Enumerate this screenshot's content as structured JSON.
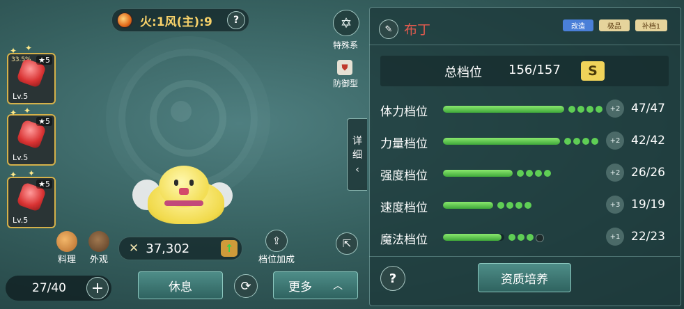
{
  "top": {
    "element_text": "火:1风(主):9",
    "help_label": "?",
    "type_label": "特殊系",
    "defense_label": "防御型",
    "type_icon": "star-of-david-icon"
  },
  "runes": [
    {
      "level": "Lv.5",
      "stars": "5",
      "pct": "33.5%"
    },
    {
      "level": "Lv.5",
      "stars": "5",
      "pct": ""
    },
    {
      "level": "Lv.5",
      "stars": "5",
      "pct": ""
    }
  ],
  "actions": {
    "cooking_label": "料理",
    "appearance_label": "外观",
    "power_value": "37,302",
    "rank_bonus_label": "档位加成",
    "count": "27/40",
    "rest_label": "休息",
    "more_label": "更多",
    "detail_label_1": "详",
    "detail_label_2": "细"
  },
  "panel": {
    "pet_name": "布丁",
    "badges": [
      "改造",
      "极品",
      "补档1"
    ],
    "total_label": "总档位",
    "total_value": "156/157",
    "grade": "S",
    "stats": [
      {
        "label": "体力档位",
        "fill": 1.0,
        "dots_filled": 4,
        "dots_total": 4,
        "bonus": "+2",
        "value": "47/47"
      },
      {
        "label": "力量档位",
        "fill": 1.0,
        "dots_filled": 4,
        "dots_total": 4,
        "bonus": "+2",
        "value": "42/42"
      },
      {
        "label": "强度档位",
        "fill": 1.0,
        "dots_filled": 4,
        "dots_total": 4,
        "bonus": "+2",
        "value": "26/26"
      },
      {
        "label": "速度档位",
        "fill": 1.0,
        "dots_filled": 4,
        "dots_total": 4,
        "bonus": "+3",
        "value": "19/19"
      },
      {
        "label": "魔法档位",
        "fill": 0.96,
        "dots_filled": 3,
        "dots_total": 4,
        "bonus": "+1",
        "value": "22/23"
      }
    ],
    "help_label": "?",
    "cultivate_label": "资质培养"
  },
  "colors": {
    "accent_gold": "#d5b14a",
    "bar_green": "#3fa83a",
    "name_red": "#e05a4e"
  }
}
